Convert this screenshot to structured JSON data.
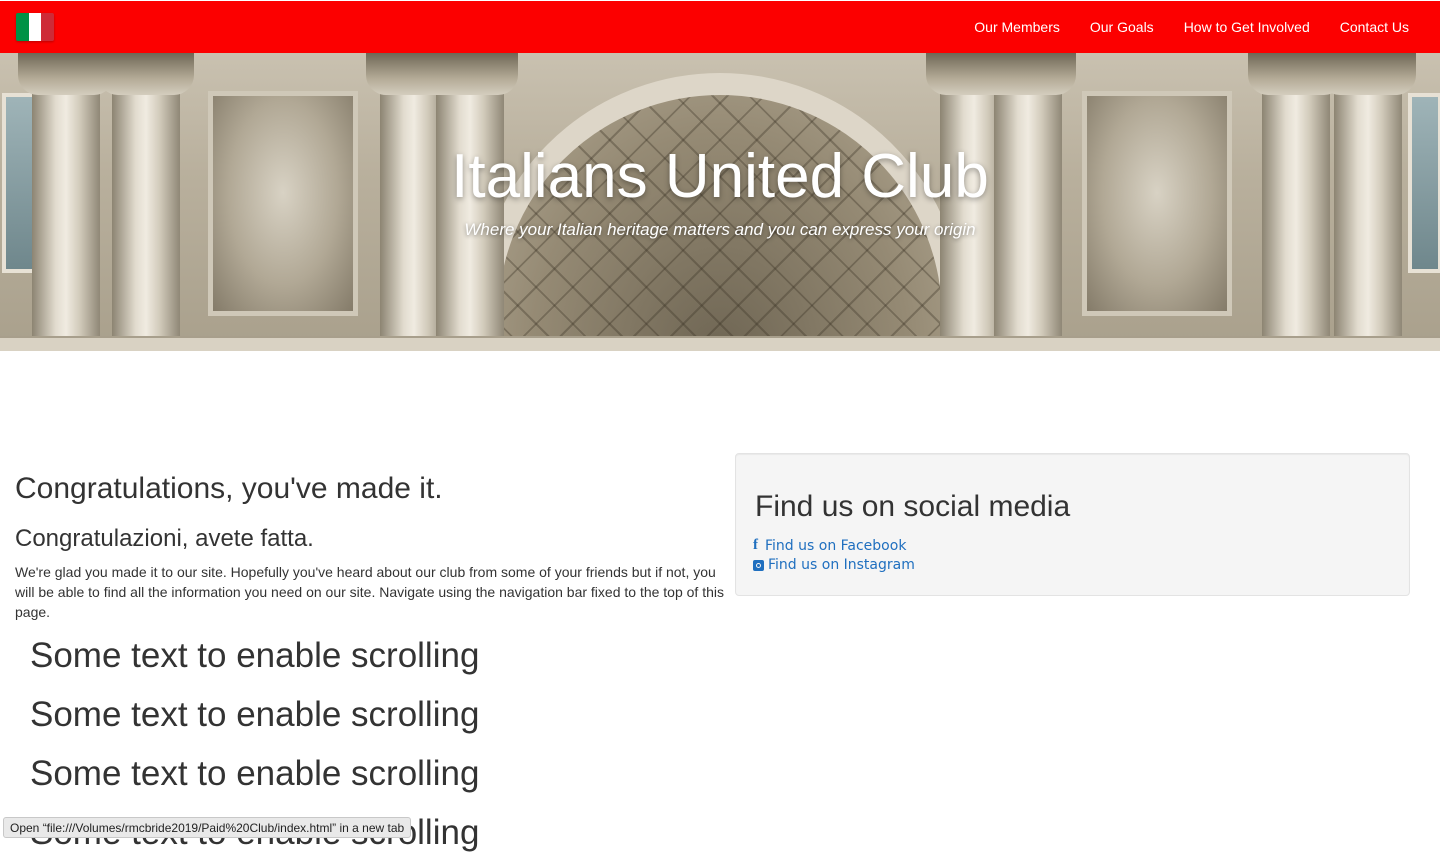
{
  "navbar": {
    "brand_icon": "italian-flag-icon",
    "flag_colors": [
      "#009246",
      "#ffffff",
      "#ce2b37"
    ],
    "background_color": "#fc0000",
    "links": [
      {
        "label": "Our Members"
      },
      {
        "label": "Our Goals"
      },
      {
        "label": "How to Get Involved"
      },
      {
        "label": "Contact Us"
      }
    ]
  },
  "hero": {
    "title": "Italians United Club",
    "subtitle": "Where your Italian heritage matters and you can express your origin",
    "background_image": "trevi-fountain-facade"
  },
  "main": {
    "heading": "Congratulations, you've made it.",
    "subheading": "Congratulazioni, avete fatta.",
    "intro": "We're glad you made it to our site. Hopefully you've heard about our club from some of your friends but if not, you will be able to find all the information you need on our site. Navigate using the navigation bar fixed to the top of this page.",
    "scroll_texts": [
      "Some text to enable scrolling",
      "Some text to enable scrolling",
      "Some text to enable scrolling",
      "Some text to enable scrolling"
    ]
  },
  "social": {
    "heading": "Find us on social media",
    "links": [
      {
        "icon": "facebook-icon",
        "label": "Find us on Facebook"
      },
      {
        "icon": "instagram-icon",
        "label": "Find us on Instagram"
      }
    ],
    "link_color": "#1f6fbf"
  },
  "status_bar": {
    "text": "Open “file:///Volumes/rmcbride2019/Paid%20Club/index.html” in a new tab"
  }
}
